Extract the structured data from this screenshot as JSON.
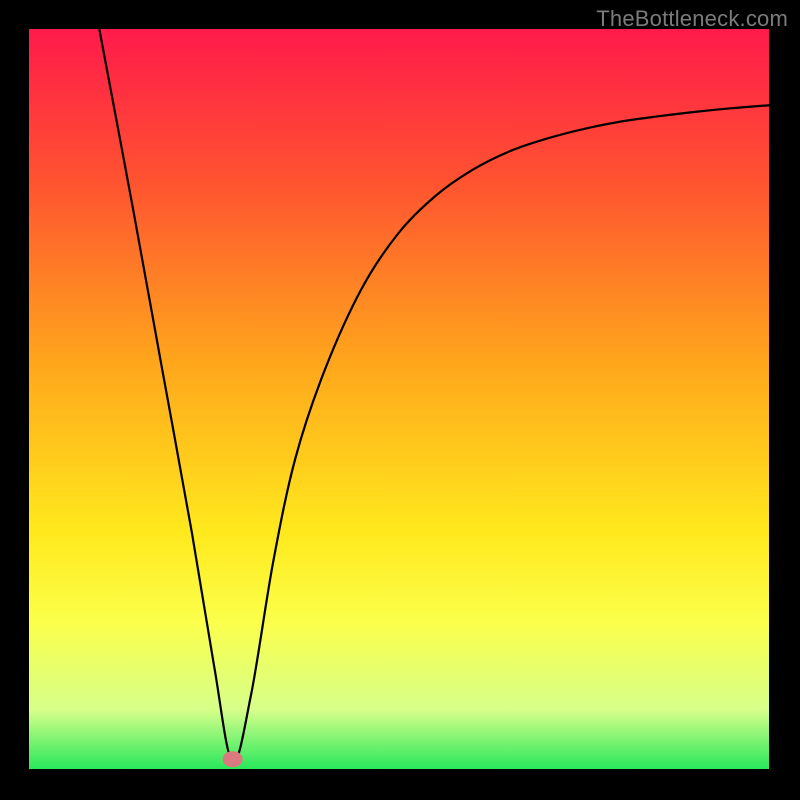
{
  "watermark": "TheBottleneck.com",
  "chart_data": {
    "type": "line",
    "title": "",
    "xlabel": "",
    "ylabel": "",
    "xlim": [
      0,
      100
    ],
    "ylim": [
      0,
      100
    ],
    "gradient_stops": [
      {
        "offset": 0,
        "color": "#ff1a4b"
      },
      {
        "offset": 20,
        "color": "#ff5131"
      },
      {
        "offset": 45,
        "color": "#ffa61c"
      },
      {
        "offset": 68,
        "color": "#ffe91d"
      },
      {
        "offset": 80,
        "color": "#fbff4a"
      },
      {
        "offset": 92,
        "color": "#d7ff8a"
      },
      {
        "offset": 100,
        "color": "#29e85c"
      }
    ],
    "marker": {
      "x": 27.5,
      "y": 1.3,
      "color": "#d97a80",
      "r": 1.4
    },
    "series": [
      {
        "name": "bottleneck-curve",
        "x": [
          9.5,
          14,
          18,
          22,
          25,
          27.5,
          30,
          33,
          36,
          40,
          45,
          50,
          55,
          60,
          65,
          70,
          75,
          80,
          85,
          90,
          95,
          100
        ],
        "y": [
          100,
          76,
          54,
          32,
          14,
          1,
          10,
          28,
          42,
          54,
          65,
          72.5,
          77.5,
          81,
          83.5,
          85.2,
          86.5,
          87.5,
          88.2,
          88.8,
          89.3,
          89.7
        ]
      }
    ],
    "stroke": {
      "color": "#000000",
      "width": 2.2
    }
  }
}
